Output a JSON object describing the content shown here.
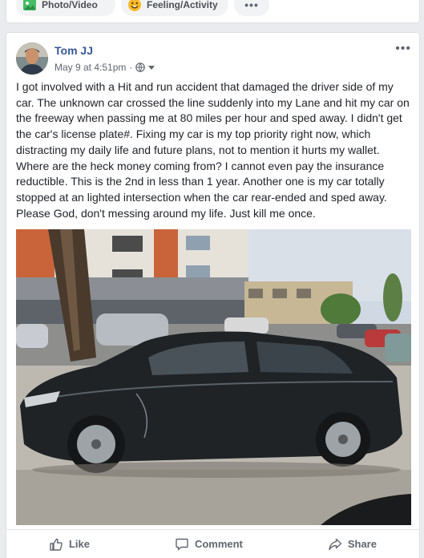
{
  "composer": {
    "photo_label": "Photo/Video",
    "feeling_label": "Feeling/Activity",
    "more_label": "•••"
  },
  "post": {
    "author": "Tom JJ",
    "timestamp": "May 9 at 4:51pm",
    "separator": "·",
    "options_label": "•••",
    "text": "I got involved with a Hit and run accident that damaged the driver side of my car. The unknown car crossed the line suddenly into my Lane and hit my car on the freeway when passing me at 80 miles per hour and sped away. I didn't get the car's license plate#. Fixing my car is my top priority right now, which distracting my daily life and future plans, not to mention it hurts my wallet. Where are the heck money coming from? I cannot even pay the insurance reductible. This is the 2nd in less than 1 year. Another one is my car totally stopped at an lighted intersection when the car rear-ended and sped away. Please God, don't messing around my life. Just kill me once."
  },
  "actions": {
    "like": "Like",
    "comment": "Comment",
    "share": "Share"
  },
  "colors": {
    "link": "#385898",
    "muted": "#606770",
    "background": "#e9ebee"
  },
  "icons": [
    "photo-icon",
    "feeling-emoji-icon",
    "globe-icon",
    "thumbs-up-icon",
    "comment-icon",
    "share-icon"
  ]
}
